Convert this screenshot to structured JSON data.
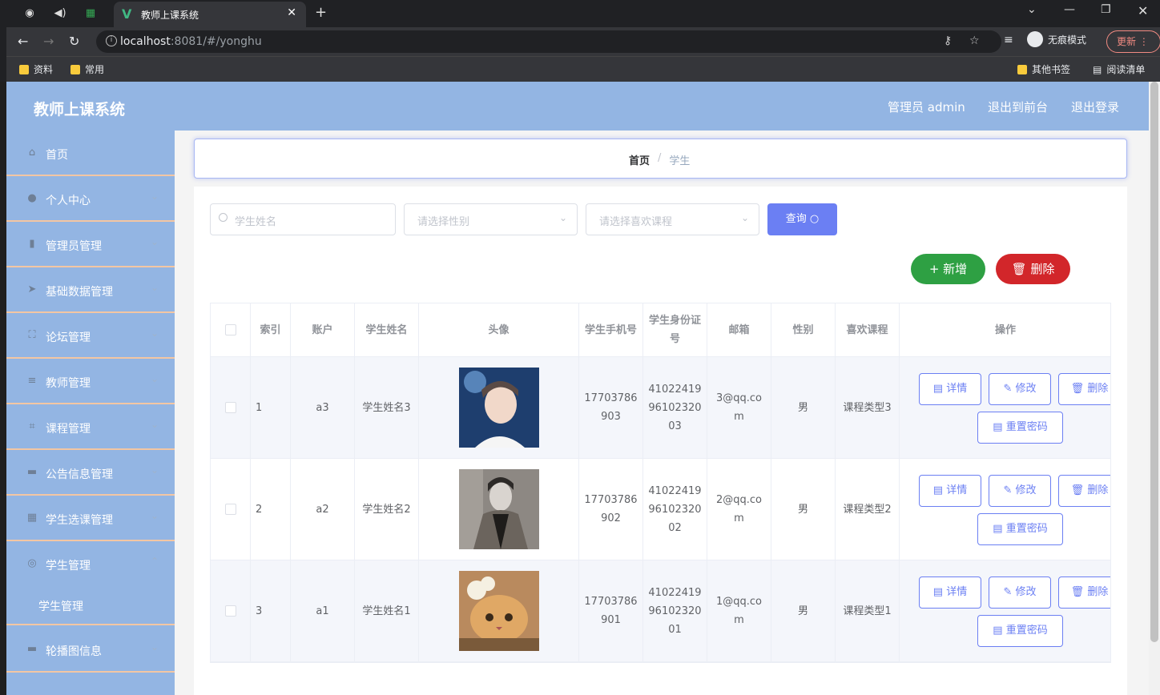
{
  "browser": {
    "tab_title": "教师上课系统",
    "url_host": "localhost",
    "url_rest": ":8081/#/yonghu",
    "incognito_label": "无痕模式",
    "update_label": "更新",
    "bookmarks": [
      "资料",
      "常用"
    ],
    "other_bookmarks": "其他书签",
    "reading_list": "阅读清单"
  },
  "header": {
    "brand": "教师上课系统",
    "user": "管理员 admin",
    "front": "退出到前台",
    "logout": "退出登录"
  },
  "sidebar": {
    "items": [
      {
        "label": "首页",
        "icon": "home-icon"
      },
      {
        "label": "个人中心",
        "icon": "user-icon"
      },
      {
        "label": "管理员管理",
        "icon": "clipboard-icon"
      },
      {
        "label": "基础数据管理",
        "icon": "send-icon"
      },
      {
        "label": "论坛管理",
        "icon": "frame-icon"
      },
      {
        "label": "教师管理",
        "icon": "list-icon"
      },
      {
        "label": "课程管理",
        "icon": "crop-icon"
      },
      {
        "label": "公告信息管理",
        "icon": "monitor-icon"
      },
      {
        "label": "学生选课管理",
        "icon": "grid-icon"
      },
      {
        "label": "学生管理",
        "icon": "compass-icon"
      },
      {
        "label": "轮播图信息",
        "icon": "monitor-icon"
      }
    ],
    "sub_item": "学生管理"
  },
  "breadcrumb": {
    "home": "首页",
    "sep": "/",
    "current": "学生"
  },
  "search": {
    "name_placeholder": "学生姓名",
    "gender_placeholder": "请选择性别",
    "course_placeholder": "请选择喜欢课程",
    "query": "查询"
  },
  "actions": {
    "add": "新增",
    "delete": "删除"
  },
  "table": {
    "headers": [
      "索引",
      "账户",
      "学生姓名",
      "头像",
      "学生手机号",
      "学生身份证号",
      "邮箱",
      "性别",
      "喜欢课程",
      "操作"
    ],
    "rows": [
      {
        "index": "1",
        "account": "a3",
        "name": "学生姓名3",
        "phone": "17703786903",
        "idcard": "410224199610232003",
        "email": "3@qq.com",
        "gender": "男",
        "course": "课程类型3"
      },
      {
        "index": "2",
        "account": "a2",
        "name": "学生姓名2",
        "phone": "17703786902",
        "idcard": "410224199610232002",
        "email": "2@qq.com",
        "gender": "男",
        "course": "课程类型2"
      },
      {
        "index": "3",
        "account": "a1",
        "name": "学生姓名1",
        "phone": "17703786901",
        "idcard": "410224199610232001",
        "email": "1@qq.com",
        "gender": "男",
        "course": "课程类型1"
      }
    ],
    "row_actions": {
      "detail": "详情",
      "edit": "修改",
      "delete": "删除",
      "reset": "重置密码"
    }
  },
  "colors": {
    "header_bg": "#93b5e3",
    "primary": "#6b7ff3",
    "add": "#2ea043",
    "danger": "#d2262a"
  }
}
